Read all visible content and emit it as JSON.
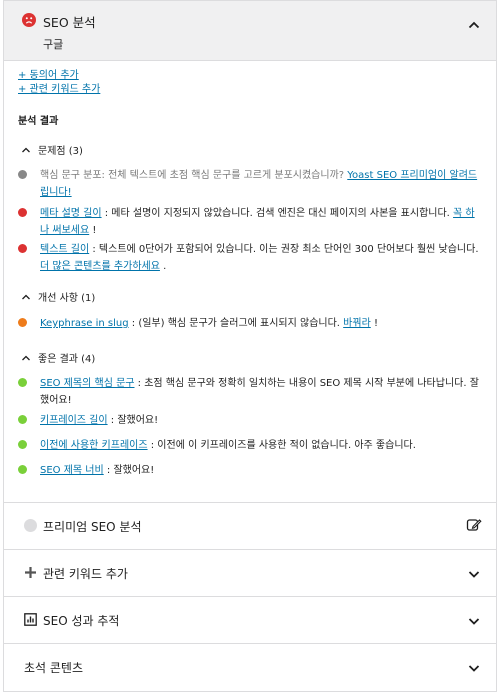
{
  "header": {
    "title": "SEO 분석",
    "subtitle": "구글",
    "status_icon": "sad-face-icon",
    "status_color": "#dc3232"
  },
  "links": {
    "add_synonym": "+ 동의어 추가",
    "add_related": "+ 관련 키워드 추가"
  },
  "analysis": {
    "title": "분석 결과",
    "problems": {
      "label": "문제점 (3)",
      "items": [
        {
          "pre": "",
          "link": "",
          "text": "핵심 문구 분포: 전체 텍스트에 초점 핵심 문구를 고르게 분포시켰습니까? ",
          "link2": "Yoast SEO 프리미엄이 알려드립니다!",
          "post": "",
          "color": "#888888"
        },
        {
          "link": "메타 설명 길이",
          "text": ": 메타 설명이 지정되지 않았습니다. 검색 엔진은 대신 페이지의 사본을 표시합니다. ",
          "link2": "꼭 하나 써보세요",
          "post": "!",
          "color": "#dc3232"
        },
        {
          "link": "텍스트 길이",
          "text": ": 텍스트에 0단어가 포함되어 있습니다. 이는 권장 최소 단어인 300 단어보다 훨씬 낮습니다. ",
          "link2": "더 많은 콘텐츠를 추가하세요",
          "post": ".",
          "color": "#dc3232"
        }
      ]
    },
    "improvements": {
      "label": "개선 사항 (1)",
      "items": [
        {
          "link": "Keyphrase in slug",
          "text": ": (일부) 핵심 문구가 슬러그에 표시되지 않습니다. ",
          "link2": "바꿔라",
          "post": "!",
          "color": "#ee7c1b"
        }
      ]
    },
    "good": {
      "label": "좋은 결과 (4)",
      "items": [
        {
          "link": "SEO 제목의 핵심 문구",
          "text": ": 초점 핵심 문구와 정확히 일치하는 내용이 SEO 제목 시작 부분에 나타납니다. 잘했어요!",
          "link2": "",
          "post": "",
          "color": "#7ad03a"
        },
        {
          "link": "키프레이즈 길이",
          "text": ": 잘했어요!",
          "link2": "",
          "post": "",
          "color": "#7ad03a"
        },
        {
          "link": "이전에 사용한 키프레이즈",
          "text": ": 이전에 이 키프레이즈를 사용한 적이 없습니다. 아주 좋습니다.",
          "link2": "",
          "post": "",
          "color": "#7ad03a"
        },
        {
          "link": "SEO 제목 너비",
          "text": ": 잘했어요!",
          "link2": "",
          "post": "",
          "color": "#7ad03a"
        }
      ]
    }
  },
  "footer": {
    "premium": "프리미엄 SEO 분석",
    "add_related": "관련 키워드 추가",
    "performance": "SEO 성과 추적",
    "cornerstone": "초석 콘텐츠"
  }
}
